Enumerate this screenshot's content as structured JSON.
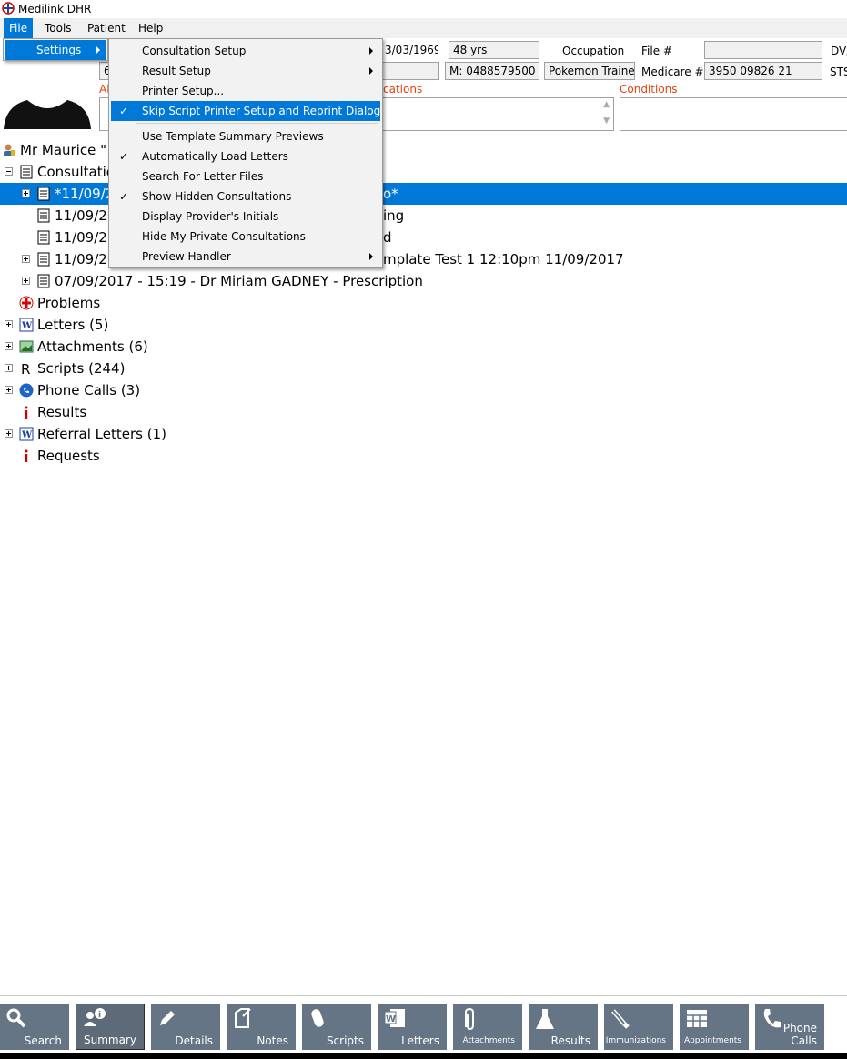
{
  "window": {
    "title": "Medilink DHR"
  },
  "menubar": [
    "File",
    "Tools",
    "Patient",
    "Help"
  ],
  "file_menu": {
    "settings_label": "Settings"
  },
  "settings_menu": [
    {
      "label": "Consultation Setup",
      "checked": false,
      "submenu": true
    },
    {
      "label": "Result Setup",
      "checked": false,
      "submenu": true
    },
    {
      "label": "Printer Setup...",
      "checked": false,
      "submenu": false
    },
    {
      "label": "Skip Script Printer Setup and Reprint Dialog",
      "checked": true,
      "submenu": false,
      "highlighted": true
    },
    {
      "label": "Use Template Summary Previews",
      "checked": false,
      "submenu": false
    },
    {
      "label": "Automatically Load Letters",
      "checked": true,
      "submenu": false
    },
    {
      "label": "Search For Letter Files",
      "checked": false,
      "submenu": false
    },
    {
      "label": "Show Hidden Consultations",
      "checked": true,
      "submenu": false
    },
    {
      "label": "Display Provider's Initials",
      "checked": false,
      "submenu": false
    },
    {
      "label": "Hide My Private Consultations",
      "checked": false,
      "submenu": false
    },
    {
      "label": "Preview Handler",
      "checked": false,
      "submenu": true
    }
  ],
  "patient_header": {
    "dob_partial": "3/03/1969",
    "age": "48 yrs",
    "occupation_label": "Occupation",
    "file_label": "File #",
    "file_value": "",
    "dva_label": "DV/",
    "address_partial": "6",
    "mobile": "M: 0488579500",
    "occupation_value": "Pokemon Trainer",
    "medicare_label": "Medicare #",
    "medicare_value": "3950 09826 21",
    "sts_label": "STS",
    "allergies_partial": "Al",
    "medications_partial": "cations",
    "conditions_label": "Conditions"
  },
  "tree": {
    "patient_name": "Mr Maurice \"",
    "consultations_label": "Consultatio",
    "consultations": [
      {
        "left": "*11/09/2",
        "right": "o*",
        "selected": true
      },
      {
        "left": "11/09/20",
        "right": "ing",
        "selected": false
      },
      {
        "left": "11/09/20",
        "right": "d",
        "selected": false
      },
      {
        "left": "11/09/20",
        "right": "mplate Test 1 12:10pm 11/09/2017",
        "selected": false
      },
      {
        "left": "07/09/2017 - 15:19 - Dr Miriam GADNEY - Prescription",
        "right": "",
        "selected": false
      }
    ],
    "sections": [
      {
        "label": "Problems",
        "icon": "plus-cross-icon"
      },
      {
        "label": "Letters (5)",
        "icon": "word-doc-icon"
      },
      {
        "label": "Attachments (6)",
        "icon": "attachment-image-icon"
      },
      {
        "label": "Scripts (244)",
        "icon": "rx-icon"
      },
      {
        "label": "Phone Calls (3)",
        "icon": "phone-icon"
      },
      {
        "label": "Results",
        "icon": "info-icon"
      },
      {
        "label": "Referral Letters (1)",
        "icon": "word-doc-icon"
      },
      {
        "label": "Requests",
        "icon": "info-icon"
      }
    ]
  },
  "toolbar": [
    {
      "label": "Search",
      "icon": "search-icon"
    },
    {
      "label": "Summary",
      "icon": "summary-icon",
      "selected": true
    },
    {
      "label": "Details",
      "icon": "pencil-icon"
    },
    {
      "label": "Notes",
      "icon": "notes-icon"
    },
    {
      "label": "Scripts",
      "icon": "pill-icon"
    },
    {
      "label": "Letters",
      "icon": "word-icon"
    },
    {
      "label": "Attachments",
      "icon": "paperclip-icon",
      "small": true
    },
    {
      "label": "Results",
      "icon": "flask-icon"
    },
    {
      "label": "Immunizations",
      "icon": "syringe-icon",
      "small": true
    },
    {
      "label": "Appointments",
      "icon": "calendar-icon",
      "small": true
    },
    {
      "label": "Phone Calls",
      "icon": "phone-icon"
    }
  ]
}
